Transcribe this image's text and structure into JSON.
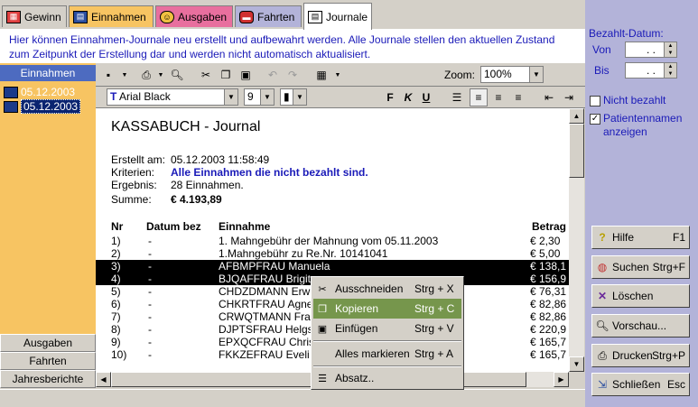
{
  "tabs": [
    {
      "label": "Gewinn",
      "icon": "gain-icon",
      "bg": "#d4d0c8"
    },
    {
      "label": "Einnahmen",
      "icon": "income-icon",
      "bg": "#f7c462"
    },
    {
      "label": "Ausgaben",
      "icon": "expense-icon",
      "bg": "#e86f9e"
    },
    {
      "label": "Fahrten",
      "icon": "car-icon",
      "bg": "#b3b3d9"
    },
    {
      "label": "Journale",
      "icon": "journal-icon",
      "bg": "#ffffff"
    }
  ],
  "info_text_1": "Hier können Einnahmen-Journale neu erstellt und aufbewahrt werden. Alle Journale stellen den aktuellen Zustand",
  "info_text_2": "zum Zeitpunkt der Erstellung dar und werden nicht automatisch aktualisiert.",
  "leftnav": {
    "header": "Einnahmen",
    "items": [
      {
        "label": "05.12.2003"
      },
      {
        "label": "05.12.2003"
      }
    ],
    "bottom_buttons": [
      "Ausgaben",
      "Fahrten",
      "Jahresberichte"
    ]
  },
  "toolbar": {
    "zoom_label": "Zoom:",
    "zoom_value": "100%",
    "font_name": "Arial Black",
    "font_size": "9"
  },
  "doc": {
    "title": "KASSABUCH - Journal",
    "erstellt_label": "Erstellt am:",
    "erstellt_value": "05.12.2003 11:58:49",
    "kriterien_label": "Kriterien:",
    "kriterien_value": "Alle Einnahmen die nicht bezahlt sind.",
    "ergebnis_label": "Ergebnis:",
    "ergebnis_value": "28 Einnahmen.",
    "summe_label": "Summe:",
    "summe_value": "€ 4.193,89",
    "columns": [
      "Nr",
      "Datum bez",
      "Einnahme",
      "Betrag"
    ],
    "rows": [
      {
        "nr": "1)",
        "datum": "-",
        "text": "1. Mahngebühr der Mahnung vom 05.11.2003",
        "betrag": "€ 2,30",
        "selected": false
      },
      {
        "nr": "2)",
        "datum": "-",
        "text": "1.Mahngebühr zu Re.Nr. 10141041",
        "betrag": "€ 5,00",
        "selected": false
      },
      {
        "nr": "3)",
        "datum": "-",
        "text": "AFBMPFRAU Manuela",
        "betrag": "€ 138,1",
        "selected": true
      },
      {
        "nr": "4)",
        "datum": "-",
        "text": "BJQAFFRAU Brigit",
        "betrag": "€ 156,9",
        "selected": true
      },
      {
        "nr": "5)",
        "datum": "-",
        "text": "CHDZDMANN Erw",
        "betrag": "€ 76,31",
        "selected": false
      },
      {
        "nr": "6)",
        "datum": "-",
        "text": "CHKRTFRAU Agne",
        "betrag": "€ 82,86",
        "selected": false
      },
      {
        "nr": "7)",
        "datum": "-",
        "text": "CRWQTMANN Fra",
        "betrag": "€ 82,86",
        "selected": false
      },
      {
        "nr": "8)",
        "datum": "-",
        "text": "DJPTSFRAU Helgs",
        "betrag": "€ 220,9",
        "selected": false
      },
      {
        "nr": "9)",
        "datum": "-",
        "text": "EPXQCFRAU Chris",
        "betrag": "€ 165,7",
        "selected": false
      },
      {
        "nr": "10)",
        "datum": "-",
        "text": "FKKZEFRAU Eveli",
        "betrag": "€ 165,7",
        "selected": false
      }
    ]
  },
  "context_menu": [
    {
      "label": "Ausschneiden",
      "shortcut": "Strg + X",
      "icon": "scissors-icon",
      "highlight": false
    },
    {
      "label": "Kopieren",
      "shortcut": "Strg + C",
      "icon": "copy-icon",
      "highlight": true
    },
    {
      "label": "Einfügen",
      "shortcut": "Strg + V",
      "icon": "paste-icon",
      "highlight": false
    },
    {
      "label": "Alles markieren",
      "shortcut": "Strg + A",
      "icon": "",
      "highlight": false
    },
    {
      "label": "Absatz..",
      "shortcut": "",
      "icon": "paragraph-icon",
      "highlight": false
    }
  ],
  "right_panel": {
    "bezahlt_label": "Bezahlt-Datum:",
    "von_label": "Von",
    "von_value": ". .",
    "bis_label": "Bis",
    "bis_value": ". .",
    "nicht_bezahlt": "Nicht bezahlt",
    "patienten_1": "Patientennamen",
    "patienten_2": "anzeigen",
    "buttons": [
      {
        "label": "Hilfe",
        "shortcut": "F1",
        "icon": "help-icon"
      },
      {
        "label": "Suchen",
        "shortcut": "Strg+F",
        "icon": "search-icon"
      },
      {
        "label": "Löschen",
        "shortcut": "",
        "icon": "delete-icon"
      },
      {
        "label": "Vorschau...",
        "shortcut": "",
        "icon": "preview-icon"
      },
      {
        "label": "Drucken",
        "shortcut": "Strg+P",
        "icon": "print-icon"
      },
      {
        "label": "Schließen",
        "shortcut": "Esc",
        "icon": "close-icon"
      }
    ]
  }
}
